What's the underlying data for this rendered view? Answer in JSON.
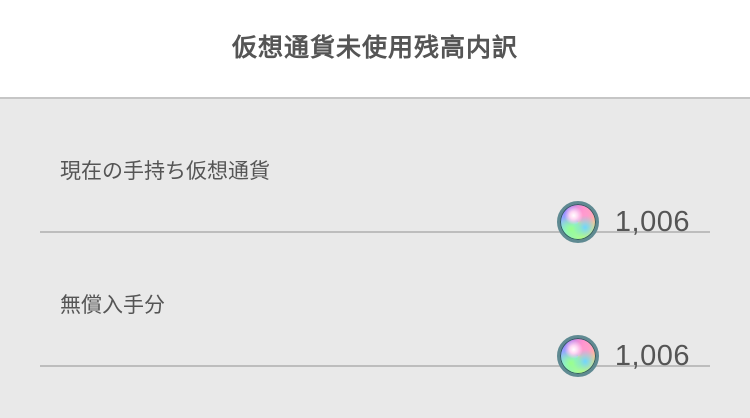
{
  "header": {
    "title": "仮想通貨未使用残高内訳"
  },
  "rows": [
    {
      "label": "現在の手持ち仮想通貨",
      "icon": "rainbow-orb-icon",
      "amount": "1,006"
    },
    {
      "label": "無償入手分",
      "icon": "rainbow-orb-icon",
      "amount": "1,006"
    }
  ],
  "colors": {
    "header_bg": "#ffffff",
    "content_bg": "#e9e9e9",
    "text": "#555555",
    "divider": "#bdbdbd"
  }
}
